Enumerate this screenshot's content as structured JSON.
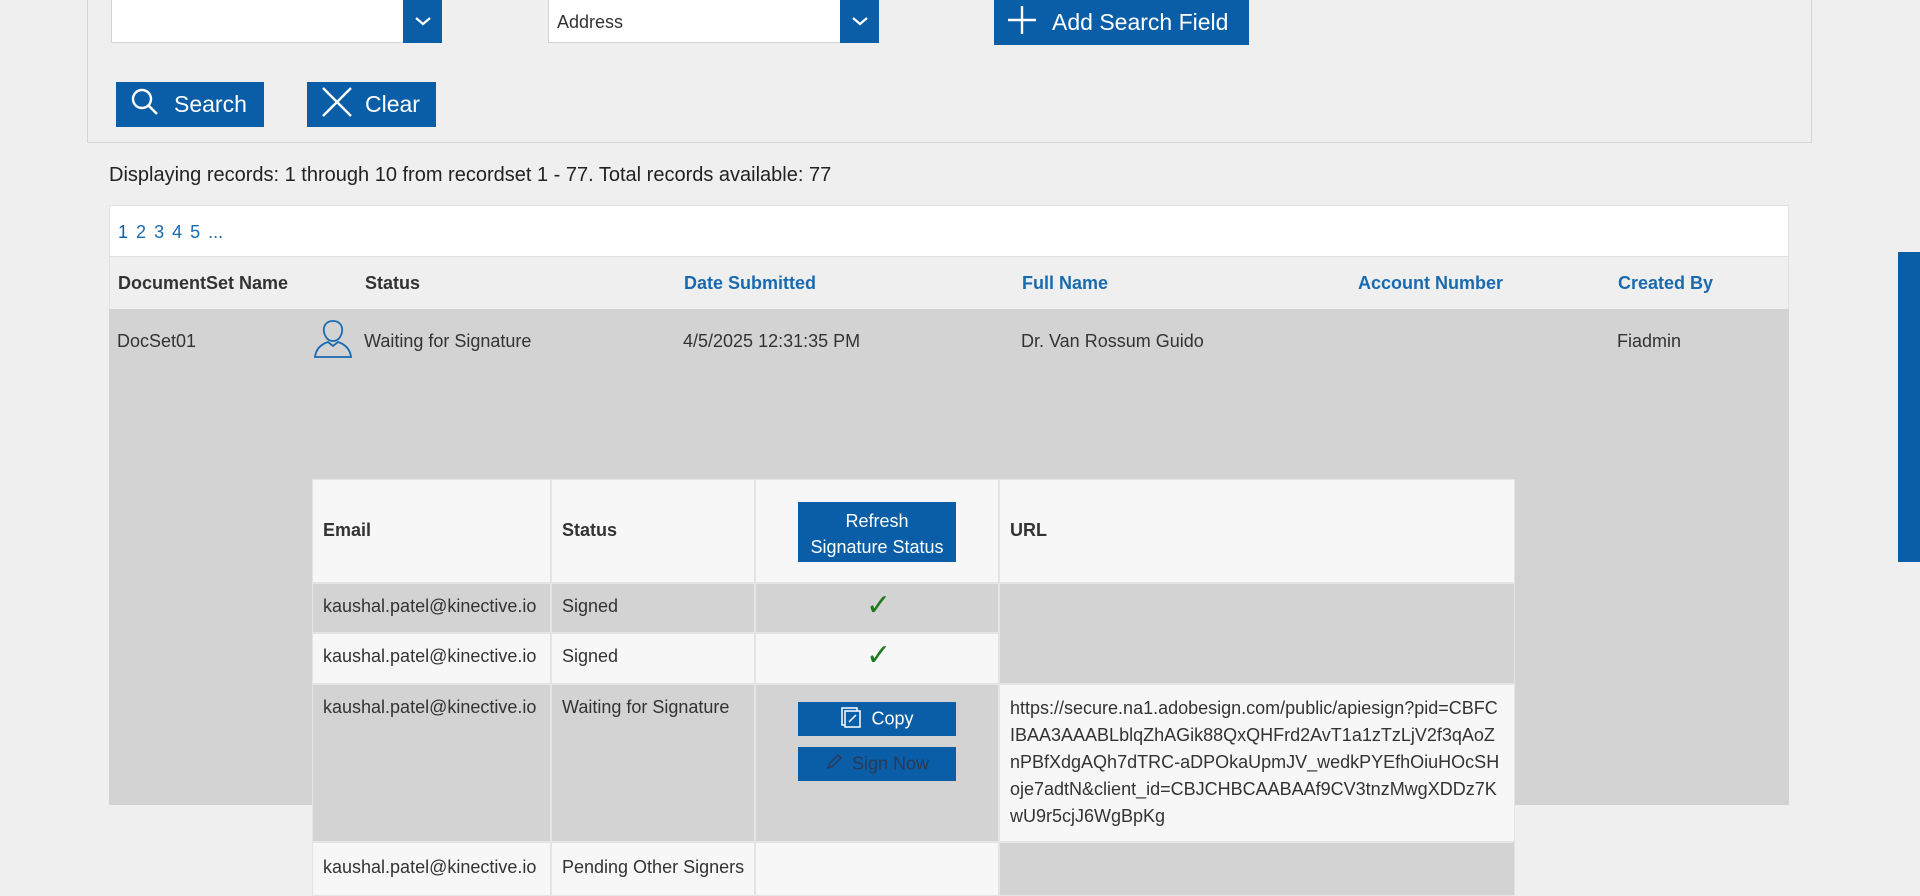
{
  "search": {
    "field1": {
      "value": ""
    },
    "field2": {
      "value": "Address"
    },
    "add_label": "Add Search Field",
    "search_label": "Search",
    "clear_label": "Clear"
  },
  "info_text": "Displaying records: 1 through 10 from recordset 1 - 77. Total records available: 77",
  "pager": {
    "pages": [
      "1",
      "2",
      "3",
      "4",
      "5"
    ],
    "more": "..."
  },
  "columns": {
    "docset": "DocumentSet Name",
    "status": "Status",
    "date": "Date Submitted",
    "fullname": "Full Name",
    "account": "Account Number",
    "created": "Created By"
  },
  "record": {
    "docset": "DocSet01",
    "status": "Waiting for Signature",
    "date": "4/5/2025 12:31:35 PM",
    "fullname": "Dr. Van Rossum Guido",
    "account": "",
    "created": "Fiadmin"
  },
  "signers": {
    "headers": {
      "email": "Email",
      "status": "Status",
      "refresh": "Refresh Signature Status",
      "url": "URL"
    },
    "rows": [
      {
        "email": "kaushal.patel@kinective.io",
        "status": "Signed",
        "check": "✓"
      },
      {
        "email": "kaushal.patel@kinective.io",
        "status": "Signed",
        "check": "✓"
      },
      {
        "email": "kaushal.patel@kinective.io",
        "status": "Waiting for Signature",
        "copy": "Copy",
        "sign": "Sign Now",
        "url": "https://secure.na1.adobesign.com/public/apiesign?pid=CBFCIBAA3AAABLblqZhAGik88QxQHFrd2AvT1a1zTzLjV2f3qAoZnPBfXdgAQh7dTRC-aDPOkaUpmJV_wedkPYEfhOiuHOcSHoje7adtN&client_id=CBJCHBCAABAAf9CV3tnzMwgXDDz7KwU9r5cjJ6WgBpKg"
      },
      {
        "email": "kaushal.patel@kinective.io",
        "status": "Pending Other Signers"
      }
    ]
  },
  "colors": {
    "accent": "#0a5ea8",
    "link": "#1a6ab0",
    "check": "#1f7a1f"
  }
}
